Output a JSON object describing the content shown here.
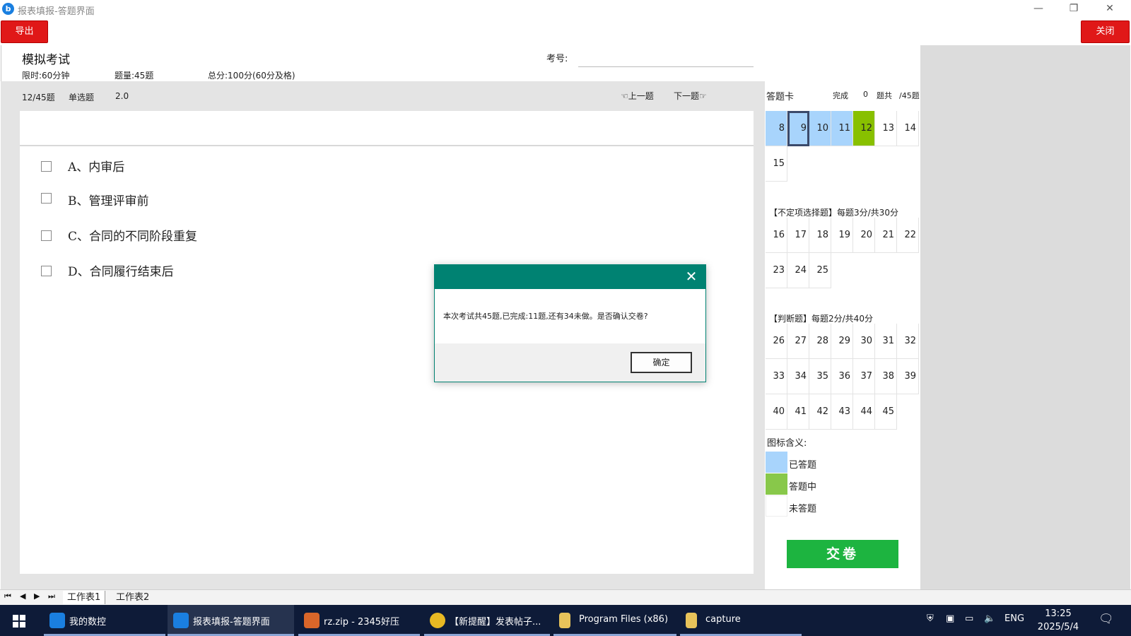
{
  "window": {
    "title": "报表填报-答题界面",
    "minimize": "—",
    "restore": "❐",
    "close": "✕"
  },
  "toolbar": {
    "export_label": "导出",
    "close_label": "关闭"
  },
  "exam": {
    "title": "模拟考试",
    "exam_no_label": "考号:",
    "time_limit": "限时:60分钟",
    "question_count": "题量:45题",
    "total_score": "总分:100分(60分及格)"
  },
  "question": {
    "progress": "12/45题",
    "type": "单选题",
    "score": "2.0",
    "prev_label": "上一题",
    "next_label": "下一题",
    "options": [
      {
        "label": "A、内审后"
      },
      {
        "label": "B、管理评审前"
      },
      {
        "label": "C、合同的不同阶段重复"
      },
      {
        "label": "D、合同履行结束后"
      }
    ]
  },
  "answer_card": {
    "title": "答题卡",
    "done_label": "完成",
    "done_count": "0",
    "total_label": "题共",
    "total_count": "/45题",
    "section1": [
      {
        "n": "8",
        "state": "done"
      },
      {
        "n": "9",
        "state": "done",
        "selected": true
      },
      {
        "n": "10",
        "state": "done"
      },
      {
        "n": "11",
        "state": "done"
      },
      {
        "n": "12",
        "state": "current"
      },
      {
        "n": "13",
        "state": "none"
      },
      {
        "n": "14",
        "state": "none"
      },
      {
        "n": "15",
        "state": "none"
      }
    ],
    "section2_title": "【不定项选择题】每题3分/共30分",
    "section2": [
      "16",
      "17",
      "18",
      "19",
      "20",
      "21",
      "22",
      "23",
      "24",
      "25"
    ],
    "section3_title": "【判断题】每题2分/共40分",
    "section3": [
      "26",
      "27",
      "28",
      "29",
      "30",
      "31",
      "32",
      "33",
      "34",
      "35",
      "36",
      "37",
      "38",
      "39",
      "40",
      "41",
      "42",
      "43",
      "44",
      "45"
    ],
    "legend_title": "图标含义:",
    "legend": [
      {
        "label": "已答题",
        "color": "#a8d4fc"
      },
      {
        "label": "答题中",
        "color": "#88c84a"
      },
      {
        "label": "未答题",
        "color": "#ffffff"
      }
    ],
    "submit_label": "交卷"
  },
  "modal": {
    "message": "本次考试共45题,已完成:11题,还有34未做。是否确认交卷?",
    "ok_label": "确定",
    "close_glyph": "✕"
  },
  "sheets": {
    "tabs": [
      "工作表1",
      "工作表2"
    ],
    "nav": [
      "⏮",
      "◀",
      "▶",
      "⏭"
    ]
  },
  "taskbar": {
    "items": [
      {
        "label": "我的数控",
        "icon_color": "#1a7fe0"
      },
      {
        "label": "报表填报-答题界面",
        "icon_color": "#1a7fe0"
      },
      {
        "label": "rz.zip - 2345好压",
        "icon_color": "#d9662a"
      },
      {
        "label": "【新提醒】发表帖子...",
        "icon_color": "#e8b923"
      },
      {
        "label": "Program Files (x86)",
        "icon_color": "#e8c35a"
      },
      {
        "label": "capture",
        "icon_color": "#e8c35a"
      }
    ],
    "lang": "ENG",
    "time": "13:25",
    "date": "2025/5/4"
  },
  "colors": {
    "accent_red": "#e01818",
    "dialog_teal": "#008272",
    "submit_green": "#1db440"
  }
}
